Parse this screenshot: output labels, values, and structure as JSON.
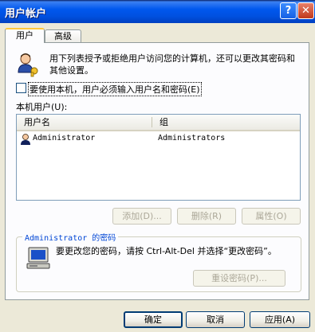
{
  "window": {
    "title": "用户帐户",
    "help_button": "?",
    "close_button": "✕"
  },
  "tabs": [
    {
      "label": "用户",
      "active": true
    },
    {
      "label": "高级",
      "active": false
    }
  ],
  "users_tab": {
    "intro_text": "用下列表授予或拒绝用户访问您的计算机，还可以更改其密码和其他设置。",
    "require_login_checkbox": {
      "label": "要使用本机，用户必须输入用户名和密码(E)",
      "checked": false
    },
    "local_users_label": "本机用户(U):",
    "table": {
      "columns": [
        "用户名",
        "组"
      ],
      "rows": [
        {
          "username": "Administrator",
          "group": "Administrators"
        }
      ]
    },
    "buttons": {
      "add": "添加(D)...",
      "remove": "删除(R)",
      "properties": "属性(O)"
    },
    "password_group": {
      "title": "Administrator 的密码",
      "text": "要更改您的密码，请按 Ctrl-Alt-Del 并选择“更改密码”。",
      "reset_button": "重设密码(P)..."
    }
  },
  "dialog_buttons": {
    "ok": "确定",
    "cancel": "取消",
    "apply": "应用(A)"
  },
  "colors": {
    "title_bar": "#0058ee",
    "group_title": "#0046d5",
    "dialog_bg": "#ece9d8"
  }
}
